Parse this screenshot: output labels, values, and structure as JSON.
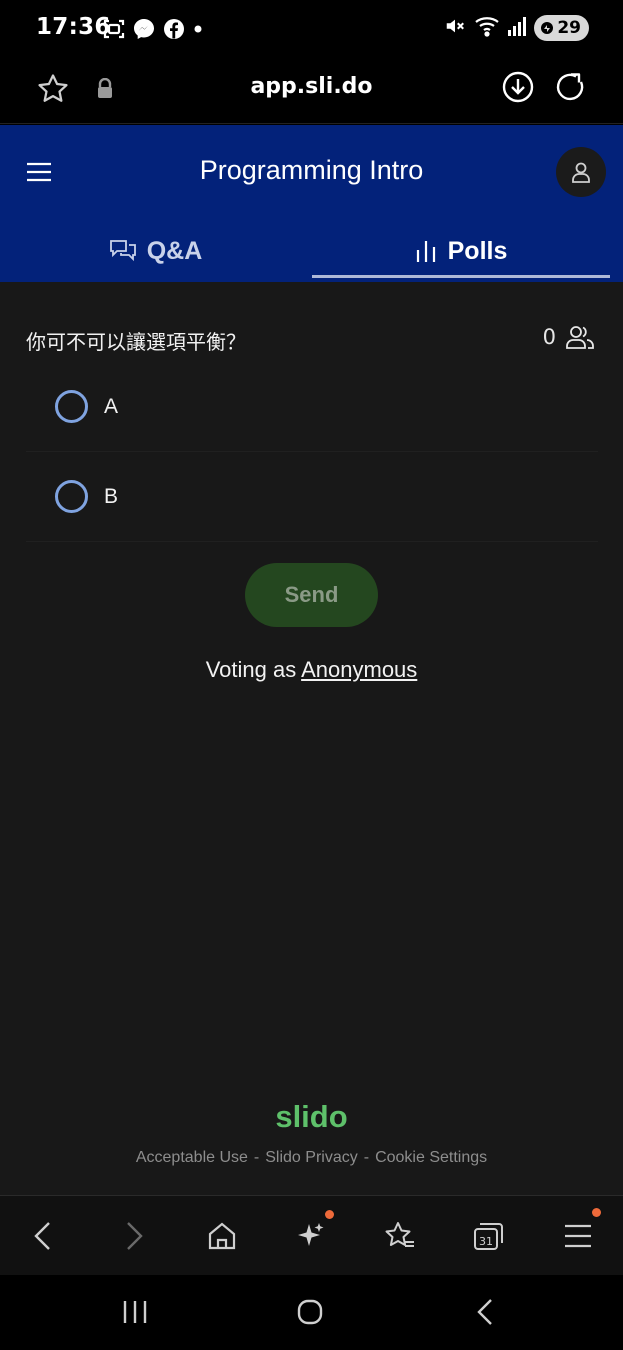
{
  "status_bar": {
    "time": "17:36",
    "battery": "29",
    "left_icons": [
      "screenshot-icon",
      "messenger-icon",
      "facebook-icon",
      "dot-icon"
    ],
    "right_icons": [
      "mute-icon",
      "wifi-icon",
      "signal-icon",
      "battery-icon"
    ]
  },
  "browser": {
    "url": "app.sli.do"
  },
  "header": {
    "title": "Programming Intro",
    "tabs": [
      {
        "label": "Q&A",
        "icon": "chat-bubbles-icon",
        "active": false
      },
      {
        "label": "Polls",
        "icon": "bar-chart-icon",
        "active": true
      }
    ]
  },
  "poll": {
    "question": "你可不可以讓選項平衡？",
    "voter_count": "0",
    "options": [
      {
        "label": "A"
      },
      {
        "label": "B"
      }
    ],
    "send_label": "Send",
    "voting_as_prefix": "Voting as",
    "voting_as_name": "Anonymous"
  },
  "footer": {
    "logo": "slido",
    "links": [
      "Acceptable Use",
      "Slido Privacy",
      "Cookie Settings"
    ],
    "separator": "-"
  },
  "colors": {
    "header_bg": "#03227a",
    "content_bg": "#181818",
    "radio_border": "#7fa3e0",
    "send_bg": "#24471f",
    "logo": "#5ec06a",
    "notification_dot": "#ee6a3a"
  }
}
